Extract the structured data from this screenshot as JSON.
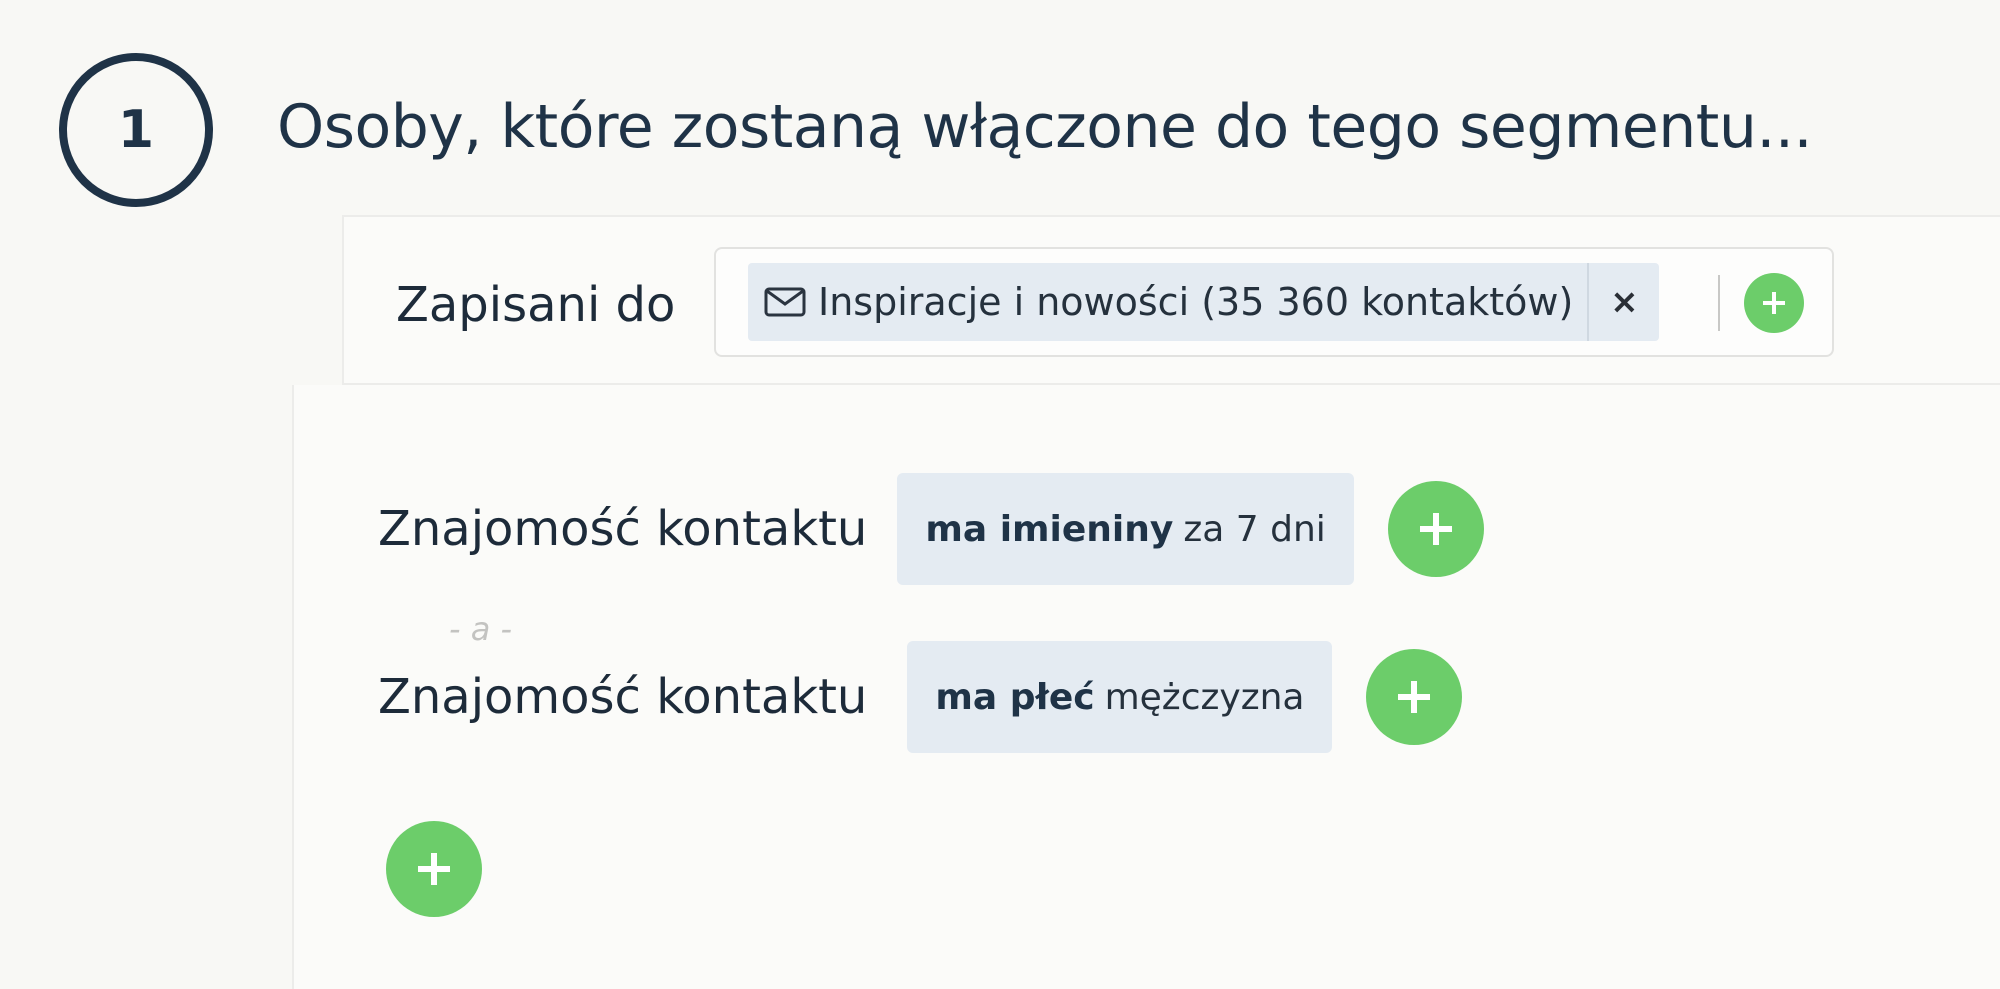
{
  "step": {
    "number": "1",
    "title": "Osoby, które zostaną włączone do tego segmentu..."
  },
  "subscription": {
    "label": "Zapisani do",
    "tag": {
      "icon": "envelope-icon",
      "text": "Inspiracje i nowości (35 360 kontaktów)",
      "remove_symbol": "×"
    },
    "add_icon": "plus-icon"
  },
  "conditions": {
    "rows": [
      {
        "label": "Znajomość kontaktu",
        "condition_bold": "ma imieniny",
        "condition_rest": "za 7 dni"
      },
      {
        "label": "Znajomość kontaktu",
        "condition_bold": "ma płeć",
        "condition_rest": "mężczyzna"
      }
    ],
    "connector": "- a -",
    "add_icon": "plus-icon"
  },
  "colors": {
    "accent_green": "#6ccd6a",
    "chip_bg": "#e4ebf2",
    "heading": "#1f3347"
  }
}
